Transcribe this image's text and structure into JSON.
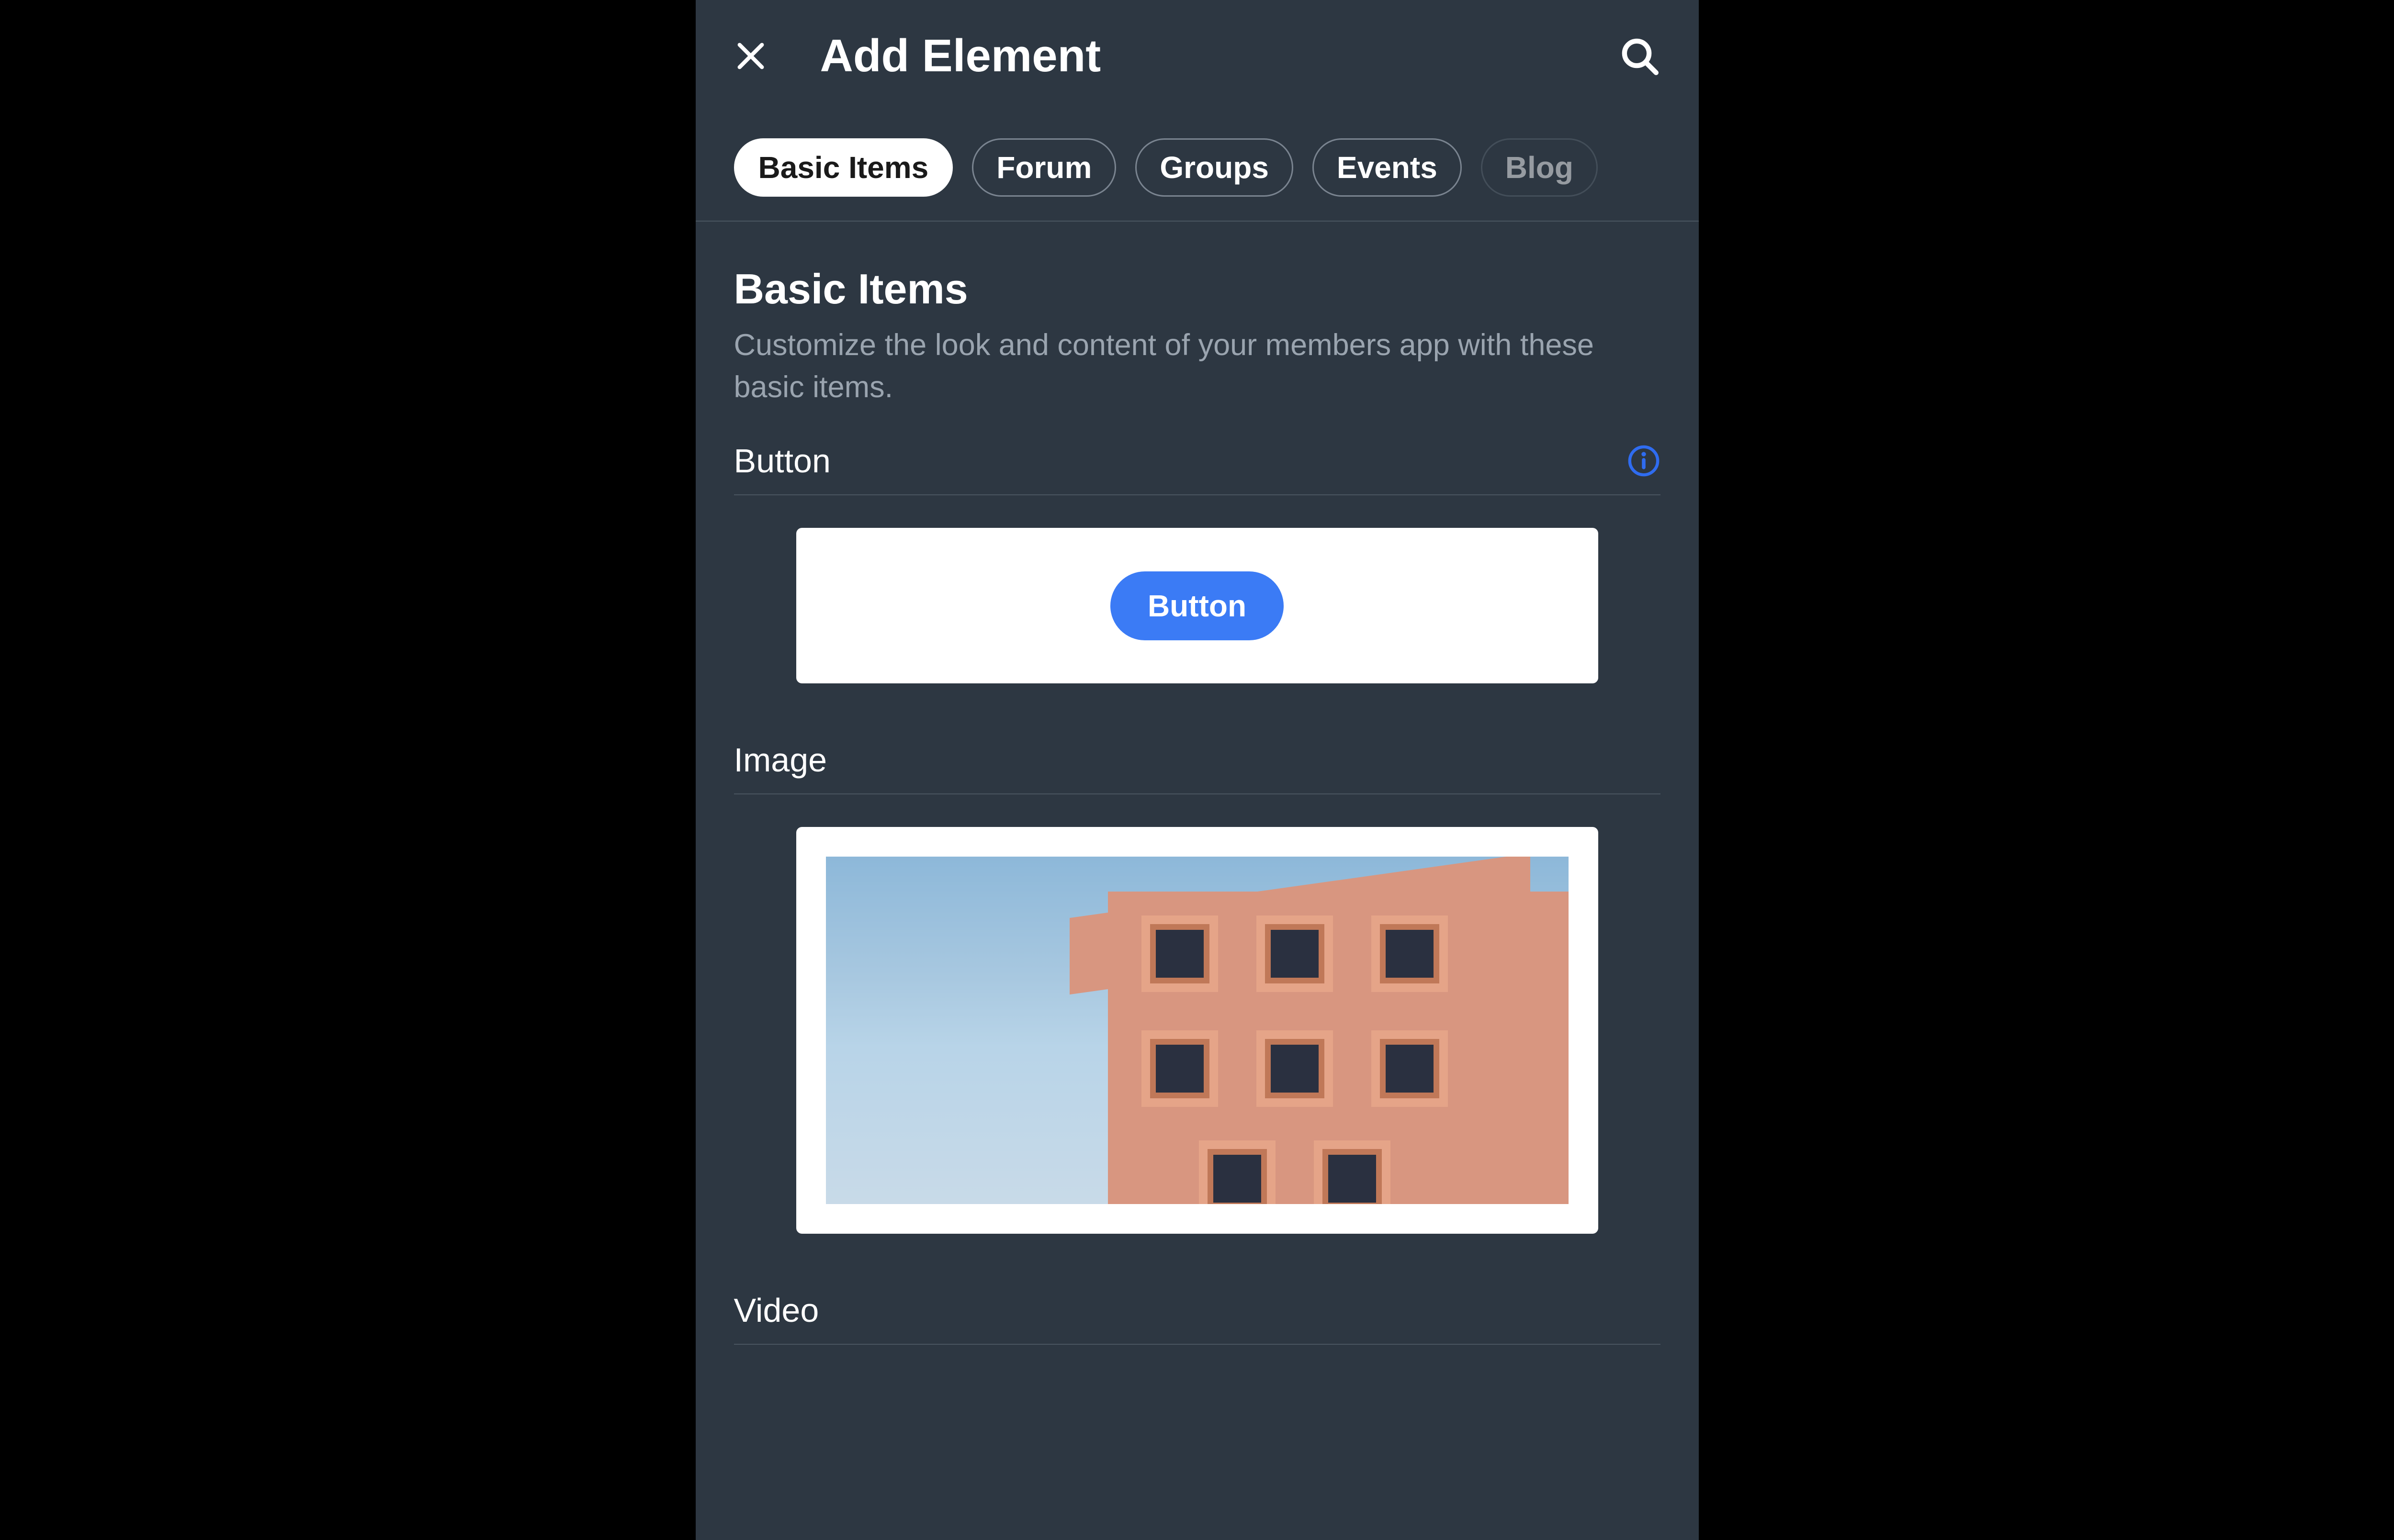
{
  "header": {
    "title": "Add Element"
  },
  "tabs": [
    {
      "label": "Basic Items",
      "active": true
    },
    {
      "label": "Forum",
      "active": false
    },
    {
      "label": "Groups",
      "active": false
    },
    {
      "label": "Events",
      "active": false
    },
    {
      "label": "Blog",
      "active": false,
      "faded": true
    }
  ],
  "section": {
    "title": "Basic Items",
    "description": "Customize the look and content of your members app with these basic items."
  },
  "elements": {
    "button": {
      "label": "Button",
      "sample_text": "Button"
    },
    "image": {
      "label": "Image"
    },
    "video": {
      "label": "Video"
    }
  },
  "colors": {
    "accent": "#3b7bf5",
    "info_icon": "#2f6cf0",
    "background": "#2d3742",
    "text_primary": "#ffffff",
    "text_secondary": "#9aa4af"
  }
}
